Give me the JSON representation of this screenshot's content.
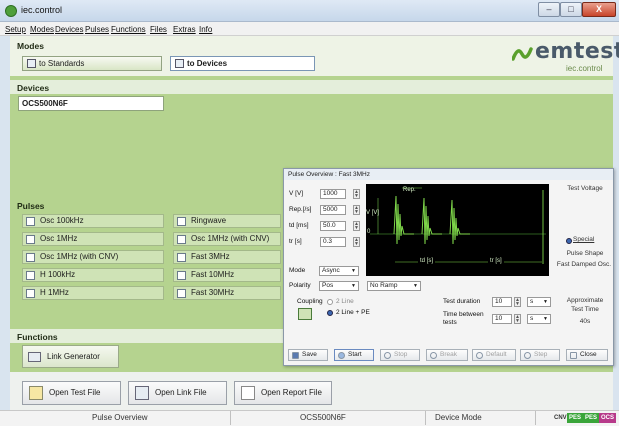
{
  "window": {
    "title": "iec.control",
    "min": "–",
    "max": "□",
    "close": "X"
  },
  "menu": [
    "Setup",
    "Modes",
    "Devices",
    "Pulses",
    "Functions",
    "Files",
    "Extras",
    "Info"
  ],
  "modes": {
    "heading": "Modes",
    "to_standards": "to Standards",
    "to_devices": "to Devices"
  },
  "logo": {
    "brand": "emtest",
    "sub": "iec.control"
  },
  "devices": {
    "heading": "Devices",
    "selected": "OCS500N6F"
  },
  "pulses": {
    "heading": "Pulses",
    "left": [
      "Osc 100kHz",
      "Osc 1MHz",
      "Osc 1MHz (with CNV)",
      "H 100kHz",
      "H 1MHz"
    ],
    "right": [
      "Ringwave",
      "Osc 1MHz (with CNV)",
      "Fast 3MHz",
      "Fast 10MHz",
      "Fast 30MHz"
    ]
  },
  "functions": {
    "heading": "Functions",
    "link_generator": "Link Generator"
  },
  "files": {
    "open_test": "Open Test File",
    "open_link": "Open Link File",
    "open_report": "Open Report File"
  },
  "status": {
    "left": "Pulse Overview",
    "center": "OCS500N6F",
    "mode": "Device Mode",
    "badges": [
      "CNV",
      "PES",
      "PES",
      "OCS"
    ]
  },
  "dialog": {
    "title": "Pulse Overview : Fast 3MHz",
    "params": [
      {
        "label": "V [V]",
        "value": "1000"
      },
      {
        "label": "Rep.[/s]",
        "value": "5000"
      },
      {
        "label": "td [ms]",
        "value": "50.0"
      },
      {
        "label": "tr [s]",
        "value": "0.3"
      }
    ],
    "mode_label": "Mode",
    "mode_value": "Async",
    "polarity_label": "Polarity",
    "polarity_value": "Pos",
    "ramp_value": "No Ramp",
    "scope": {
      "rep": "Rep.",
      "v": "V [V]",
      "zero": "0",
      "td": "td [s]",
      "tr": "tr [s]"
    },
    "test_voltage": "Test Voltage",
    "special": "Special",
    "pulse_shape_label": "Pulse Shape",
    "pulse_shape_value": "Fast Damped Osc.",
    "coupling_label": "Coupling",
    "coupling_opt1": "2 Line",
    "coupling_opt2": "2 Line + PE",
    "test_duration_label": "Test duration",
    "test_duration_value": "10",
    "test_duration_unit": "s",
    "between_label_1": "Time between",
    "between_label_2": "tests",
    "between_value": "10",
    "between_unit": "s",
    "approx_1": "Approximate",
    "approx_2": "Test Time",
    "approx_value": "40s",
    "buttons": {
      "save": "Save",
      "start": "Start",
      "stop": "Stop",
      "break": "Break",
      "default": "Default",
      "step": "Step",
      "close": "Close"
    }
  }
}
